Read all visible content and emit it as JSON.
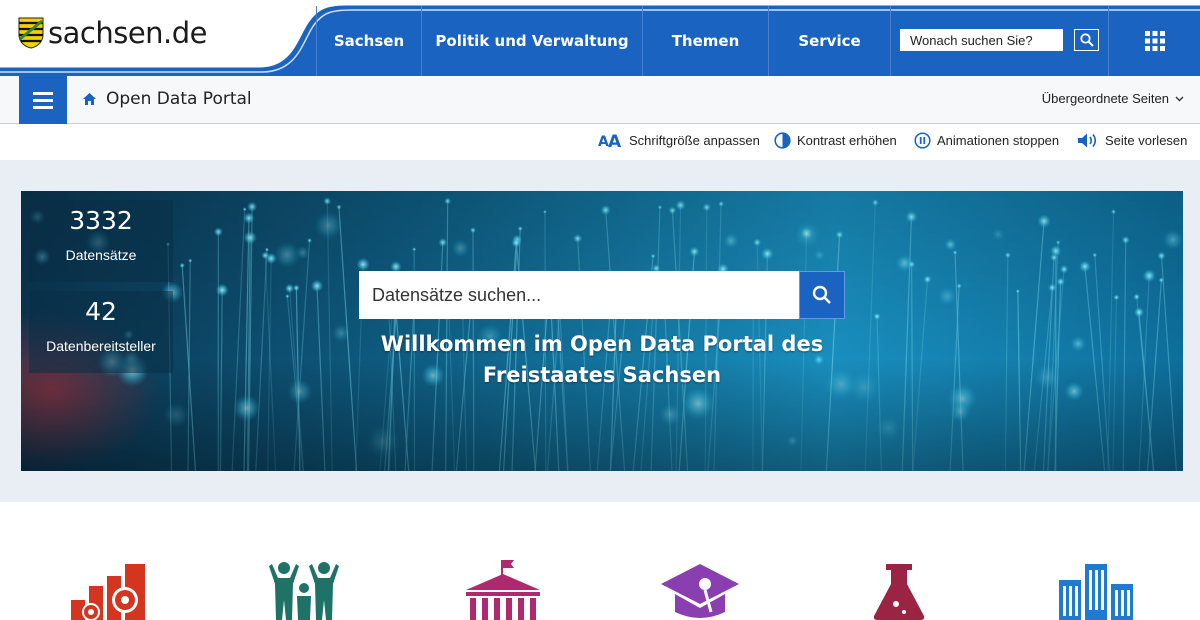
{
  "header": {
    "logo_text": "sachsen.de",
    "nav": [
      {
        "label": "Sachsen"
      },
      {
        "label": "Politik und Verwaltung"
      },
      {
        "label": "Themen"
      },
      {
        "label": "Service"
      }
    ],
    "search_placeholder": "Wonach suchen Sie?"
  },
  "breadcrumb": {
    "title": "Open Data Portal",
    "parent_pages": "Übergeordnete Seiten"
  },
  "accessibility": {
    "font_size": "Schriftgröße anpassen",
    "contrast": "Kontrast erhöhen",
    "animations": "Animationen stoppen",
    "read_aloud": "Seite vorlesen"
  },
  "hero": {
    "stats": [
      {
        "value": "3332",
        "label": "Datensätze"
      },
      {
        "value": "42",
        "label": "Datenbereitsteller"
      }
    ],
    "search_placeholder": "Datensätze suchen...",
    "welcome_line1": "Willkommen im Open Data Portal des",
    "welcome_line2": "Freistaates Sachsen"
  },
  "categories": [
    {
      "icon": "economy-gears-icon",
      "color": "#d3351f"
    },
    {
      "icon": "people-icon",
      "color": "#1f7266"
    },
    {
      "icon": "government-building-icon",
      "color": "#b0296f"
    },
    {
      "icon": "education-cap-icon",
      "color": "#8a3fb0"
    },
    {
      "icon": "science-flask-icon",
      "color": "#9b2343"
    },
    {
      "icon": "city-buildings-icon",
      "color": "#1f7ad1"
    }
  ],
  "colors": {
    "primary_blue": "#1a63c0",
    "hero_overlay": "#0a3550"
  }
}
